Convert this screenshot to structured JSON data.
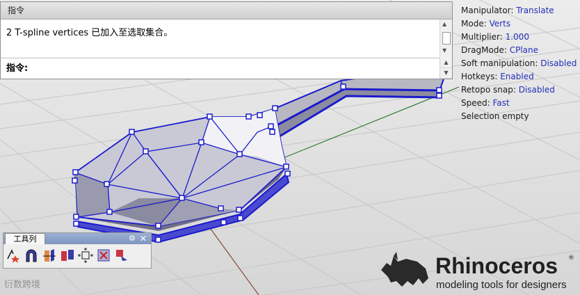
{
  "command_window": {
    "title": "指令",
    "history_line": "2 T-spline vertices 已加入至选取集合。",
    "prompt_label": "指令:"
  },
  "hud": [
    {
      "key": "Manipulator:",
      "value": "Translate"
    },
    {
      "key": "Mode:",
      "value": "Verts"
    },
    {
      "key": "Multiplier:",
      "value": "1.000"
    },
    {
      "key": "DragMode:",
      "value": "CPlane"
    },
    {
      "key": "Soft manipulation:",
      "value": "Disabled"
    },
    {
      "key": "Hotkeys:",
      "value": "Enabled"
    },
    {
      "key": "Retopo snap:",
      "value": "Disabled"
    },
    {
      "key": "Speed:",
      "value": "Fast"
    },
    {
      "key": "Selection empty",
      "value": ""
    }
  ],
  "toolbar": {
    "tab_label": "工具列",
    "tools": [
      "transform-tool-icon",
      "magnet-tool-icon",
      "extrude-tool-icon",
      "bridge-tool-icon",
      "weld-tool-icon",
      "delete-tool-icon",
      "retopo-tool-icon"
    ]
  },
  "logo": {
    "name": "Rhinoceros",
    "registered": "®",
    "tagline": "modeling tools for designers"
  },
  "watermark": "衍数跨境",
  "colors": {
    "selection_blue": "#1a1acc",
    "hud_value": "#2430b8",
    "viewport_bg": "#dcdcdc",
    "grid_line": "#c4c4c4",
    "axis_green": "#2f7a2f",
    "axis_red": "#8a4a3a",
    "toolbar_title": "#8ca2c8"
  }
}
